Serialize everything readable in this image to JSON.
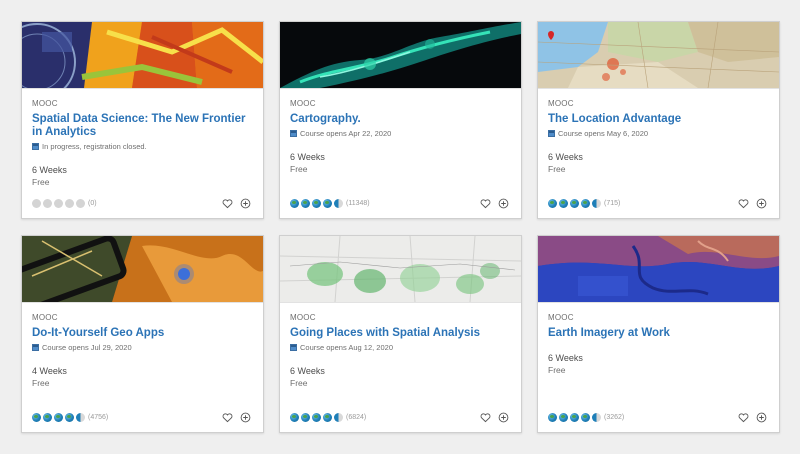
{
  "courses": [
    {
      "tag": "MOOC",
      "title": "Spatial Data Science: The New Frontier in Analytics",
      "status": "In progress, registration closed.",
      "duration": "6 Weeks",
      "price": "Free",
      "rating": {
        "value": 0,
        "count": "(0)"
      },
      "thumb": "spatial-data-science-map"
    },
    {
      "tag": "MOOC",
      "title": "Cartography.",
      "status": "Course opens Apr 22, 2020",
      "duration": "6 Weeks",
      "price": "Free",
      "rating": {
        "value": 4.5,
        "count": "(11348)"
      },
      "thumb": "cartography-dark-map"
    },
    {
      "tag": "MOOC",
      "title": "The Location Advantage",
      "status": "Course opens May 6, 2020",
      "duration": "6 Weeks",
      "price": "Free",
      "rating": {
        "value": 4.5,
        "count": "(715)"
      },
      "thumb": "location-advantage-map"
    },
    {
      "tag": "MOOC",
      "title": "Do-It-Yourself Geo Apps",
      "status": "Course opens Jul 29, 2020",
      "duration": "4 Weeks",
      "price": "Free",
      "rating": {
        "value": 4.5,
        "count": "(4756)"
      },
      "thumb": "diy-geo-apps-map"
    },
    {
      "tag": "MOOC",
      "title": "Going Places with Spatial Analysis",
      "status": "Course opens Aug 12, 2020",
      "duration": "6 Weeks",
      "price": "Free",
      "rating": {
        "value": 4.5,
        "count": "(6824)"
      },
      "thumb": "spatial-analysis-map"
    },
    {
      "tag": "MOOC",
      "title": "Earth Imagery at Work",
      "status": "",
      "duration": "6 Weeks",
      "price": "Free",
      "rating": {
        "value": 4.5,
        "count": "(3262)"
      },
      "thumb": "earth-imagery-map"
    }
  ],
  "icons": {
    "status": "calendar-icon",
    "favorite": "heart-icon",
    "add": "add-circle-icon",
    "rating": "globe-icon"
  },
  "colors": {
    "title": "#2b73b6",
    "background": "#efefef",
    "globe": "#1f7fb8"
  }
}
